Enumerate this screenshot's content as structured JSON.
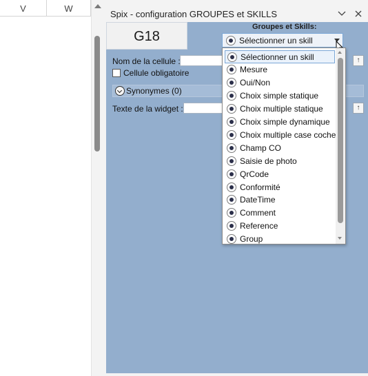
{
  "sheet": {
    "columns": [
      "V",
      "W"
    ]
  },
  "panel": {
    "title": "Spix - configuration GROUPES et SKILLS",
    "cell_ref": "G18",
    "groups_label": "Groupes et Skills:",
    "select_value": "Sélectionner un skill",
    "cell_name_label": "Nom de la cellule :",
    "required_label": "Cellule obligatoire",
    "synonyms_label": "Synonymes (0)",
    "widget_text_label": "Texte de la widget :",
    "arrow_symbol": "↑"
  },
  "dropdown": {
    "items": [
      "Sélectionner un skill",
      "Mesure",
      "Oui/Non",
      "Choix simple statique",
      "Choix multiple statique",
      "Choix simple dynamique",
      "Choix multiple case cocher",
      "Champ CO",
      "Saisie de photo",
      "QrCode",
      "Conformité",
      "DateTime",
      "Comment",
      "Reference",
      "Group"
    ],
    "selected_index": 0
  },
  "colors": {
    "panel_bg": "#93aecd",
    "accent": "#7aa6d6"
  }
}
